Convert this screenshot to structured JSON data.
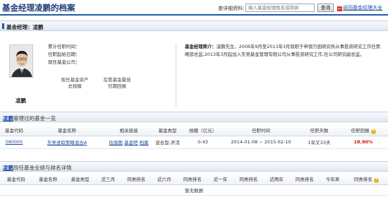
{
  "header": {
    "title": "基金经理凌鹏的档案",
    "query_label": "查详细资料：",
    "search_placeholder": "输入基金经理姓名或简拼",
    "search_button": "查询",
    "return_link": "返回基金经理大全"
  },
  "profile_section": {
    "title": "基金经理：凌鹏"
  },
  "profile": {
    "name": "凌鹏",
    "info": [
      "累计任职时间：",
      "任职起始日期：",
      "现任基金公司："
    ],
    "stats": [
      {
        "line1": "现任基金资产",
        "line2": "总规模"
      },
      {
        "line1": "在管基金最佳",
        "line2": "任期回报"
      }
    ],
    "bio_label": "基金经理简介：",
    "bio_text": "凌鹏先生，2006年9月至2013年3月就职于申银万国研究所从事投资研究工作任策略部总监;2013年3月起加入东吴基金管理有限公司从事投资研究工作,任公司研究副总监。"
  },
  "funds_section": {
    "name_link": "凌鹏",
    "title_suffix": "管理过的基金一览"
  },
  "funds_table": {
    "headers": [
      "基金代码",
      "基金名称",
      "相关链接",
      "基金类型",
      "规模（亿元）",
      "任职时间",
      "任职天数",
      "任职回报"
    ],
    "rows": [
      {
        "code": "580005",
        "name": "东吴进取策略混合A",
        "links": [
          "估值图",
          "基金吧",
          "档案"
        ],
        "type": "混合型-灵活",
        "scale": "0.43",
        "period": "2014-01-08 ~ 2015-02-10",
        "days": "1年又33天",
        "return": "18.90%"
      }
    ]
  },
  "perf_section": {
    "name_link": "凌鹏",
    "title_suffix": "现任基金业绩与排名详情"
  },
  "perf_table": {
    "headers": [
      "基金代码",
      "基金名称",
      "基金类型",
      "近三月",
      "同类排名",
      "近六月",
      "同类排名",
      "近一年",
      "同类排名",
      "近两年",
      "同类排名",
      "今年来",
      "同类排名"
    ],
    "empty_text": "暂无数据"
  },
  "colors": {
    "accent": "#1f5aa6",
    "return_red": "#d31010",
    "help_icon": "#f2b31b"
  },
  "icons": [
    "return-icon",
    "help-icon",
    "avatar"
  ]
}
